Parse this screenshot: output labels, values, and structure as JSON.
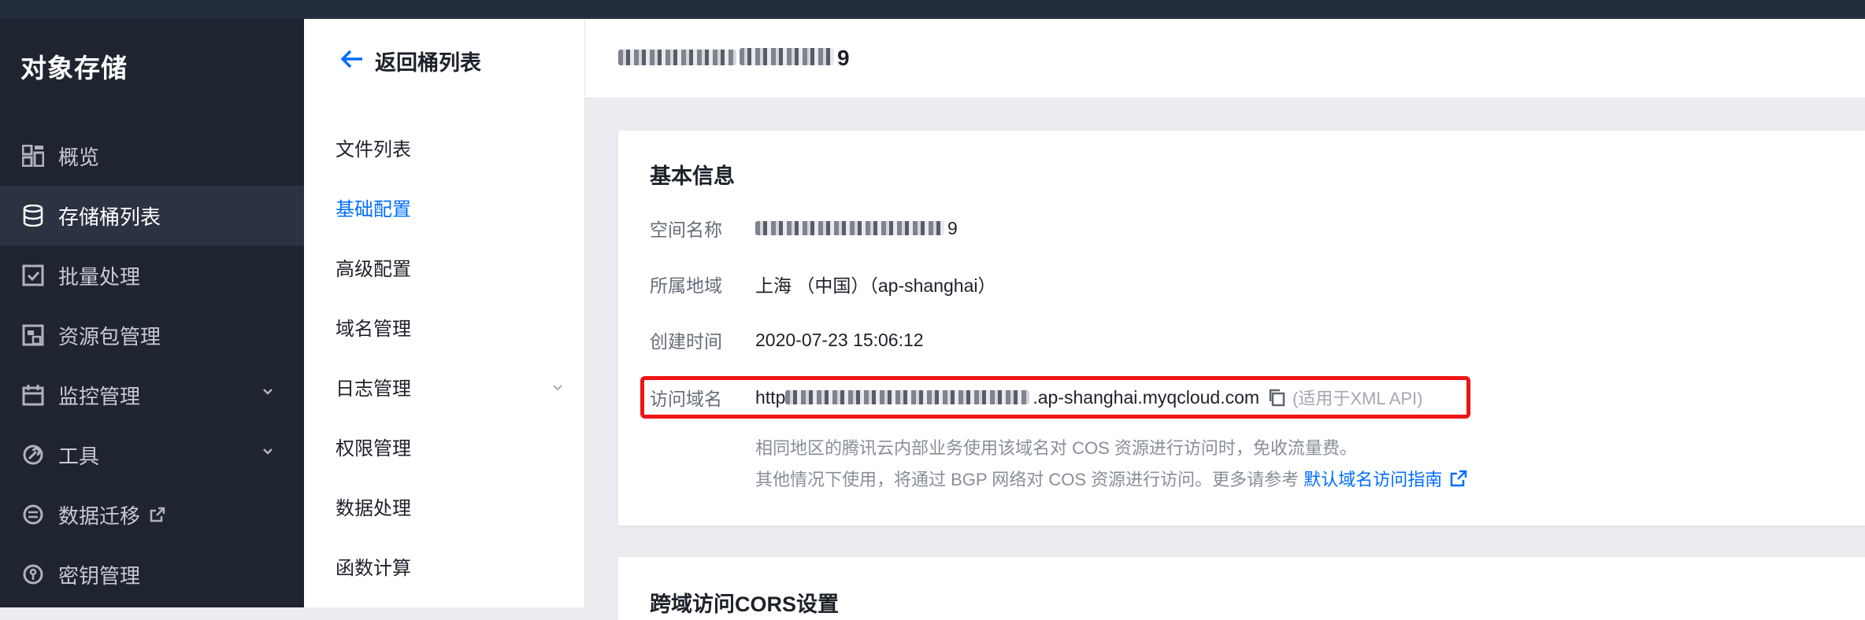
{
  "sidebar": {
    "brand": "对象存储",
    "items": [
      {
        "label": "概览",
        "icon": "grid-icon"
      },
      {
        "label": "存储桶列表",
        "icon": "database-icon"
      },
      {
        "label": "批量处理",
        "icon": "checklist-icon"
      },
      {
        "label": "资源包管理",
        "icon": "package-icon"
      },
      {
        "label": "监控管理",
        "icon": "calendar-icon"
      },
      {
        "label": "工具",
        "icon": "tool-icon"
      },
      {
        "label": "数据迁移",
        "icon": "migration-icon"
      },
      {
        "label": "密钥管理",
        "icon": "key-icon"
      }
    ],
    "active_index": 1
  },
  "submenu": {
    "back_label": "返回桶列表",
    "items": [
      {
        "label": "文件列表"
      },
      {
        "label": "基础配置"
      },
      {
        "label": "高级配置"
      },
      {
        "label": "域名管理"
      },
      {
        "label": "日志管理"
      },
      {
        "label": "权限管理"
      },
      {
        "label": "数据处理"
      },
      {
        "label": "函数计算"
      }
    ],
    "active_index": 1
  },
  "header": {
    "bucket_name_suffix": "9"
  },
  "basic_info": {
    "title": "基本信息",
    "fields": {
      "bucket_name": {
        "label": "空间名称",
        "value_suffix": "9"
      },
      "region": {
        "label": "所属地域",
        "value": "上海 （中国）（ap-shanghai）"
      },
      "created": {
        "label": "创建时间",
        "value": "2020-07-23 15:06:12"
      },
      "domain": {
        "label": "访问域名",
        "value_prefix": "http",
        "value_suffix": ".ap-shanghai.myqcloud.com",
        "hint": "(适用于XML API)"
      }
    },
    "note_line1": "相同地区的腾讯云内部业务使用该域名对 COS 资源进行访问时，免收流量费。",
    "note_line2": "其他情况下使用，将通过 BGP 网络对 COS 资源进行访问。更多请参考",
    "note_link": "默认域名访问指南"
  },
  "cors": {
    "title": "跨域访问CORS设置"
  },
  "colors": {
    "accent": "#006eff",
    "highlight_border": "#ee1515",
    "sidebar_bg": "#1f2431"
  }
}
